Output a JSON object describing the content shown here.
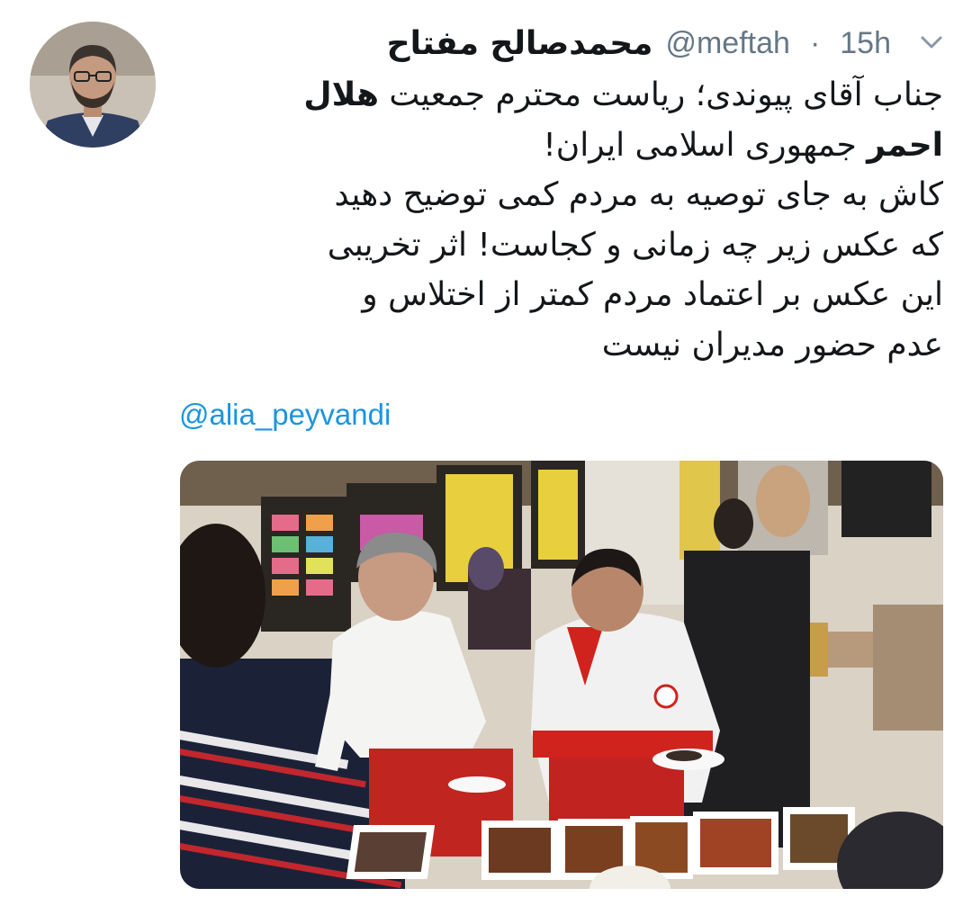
{
  "tweet": {
    "author_name": "محمدصالح مفتاح",
    "handle": "@meftah",
    "separator": "·",
    "time": "15h",
    "text_lines": [
      {
        "plain": "جناب آقای پیوندی؛ ریاست محترم جمعیت ",
        "bold": "هلال"
      },
      {
        "bold": "احمر",
        "plain": " جمهوری اسلامی ایران!"
      },
      {
        "plain": " کاش به جای توصیه به مردم کمی توضیح دهید"
      },
      {
        "plain": "که عکس زیر چه زمانی و کجاست! اثر تخریبی"
      },
      {
        "plain": "این عکس بر اعتماد مردم کمتر از اختلاس و"
      },
      {
        "plain": "عدم حضور مدیران نیست"
      }
    ],
    "mention": "@alia_peyvandi"
  },
  "icons": {
    "menu": "chevron-down-icon"
  },
  "colors": {
    "link": "#1b95e0",
    "secondary_text": "#657786",
    "primary_text": "#14171a",
    "vest_red": "#d0231d"
  }
}
